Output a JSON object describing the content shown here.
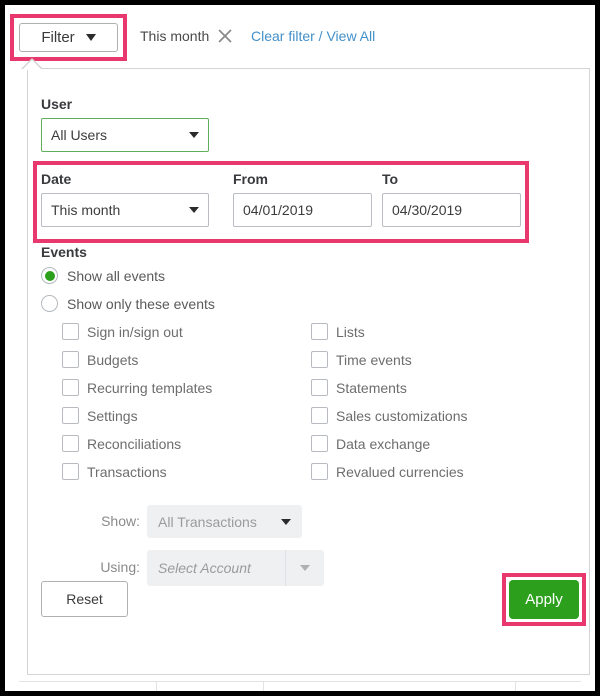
{
  "topbar": {
    "filter_button_label": "Filter",
    "filter_chip_label": "This month",
    "close_icon": "close-x-icon",
    "clear_filter_link": "Clear filter / View All"
  },
  "panel": {
    "user": {
      "label": "User",
      "selected": "All Users"
    },
    "date": {
      "label": "Date",
      "selected": "This month"
    },
    "from": {
      "label": "From",
      "value": "04/01/2019"
    },
    "to": {
      "label": "To",
      "value": "04/30/2019"
    },
    "events": {
      "label": "Events",
      "radios": [
        {
          "label": "Show all events",
          "selected": true
        },
        {
          "label": "Show only these events",
          "selected": false
        }
      ],
      "checkboxes_left": [
        {
          "label": "Sign in/sign out",
          "checked": false
        },
        {
          "label": "Budgets",
          "checked": false
        },
        {
          "label": "Recurring templates",
          "checked": false
        },
        {
          "label": "Settings",
          "checked": false
        },
        {
          "label": "Reconciliations",
          "checked": false
        },
        {
          "label": "Transactions",
          "checked": false
        }
      ],
      "checkboxes_right": [
        {
          "label": "Lists",
          "checked": false
        },
        {
          "label": "Time events",
          "checked": false
        },
        {
          "label": "Statements",
          "checked": false
        },
        {
          "label": "Sales customizations",
          "checked": false
        },
        {
          "label": "Data exchange",
          "checked": false
        },
        {
          "label": "Revalued currencies",
          "checked": false
        }
      ]
    },
    "show": {
      "label": "Show:",
      "selected": "All Transactions"
    },
    "using": {
      "label": "Using:",
      "placeholder": "Select Account"
    },
    "footer": {
      "reset_label": "Reset",
      "apply_label": "Apply"
    }
  },
  "colors": {
    "highlight_pink": "#e8386e",
    "primary_green": "#2ca01c",
    "link_blue": "#4490c8",
    "focus_green": "#5fae5c"
  }
}
